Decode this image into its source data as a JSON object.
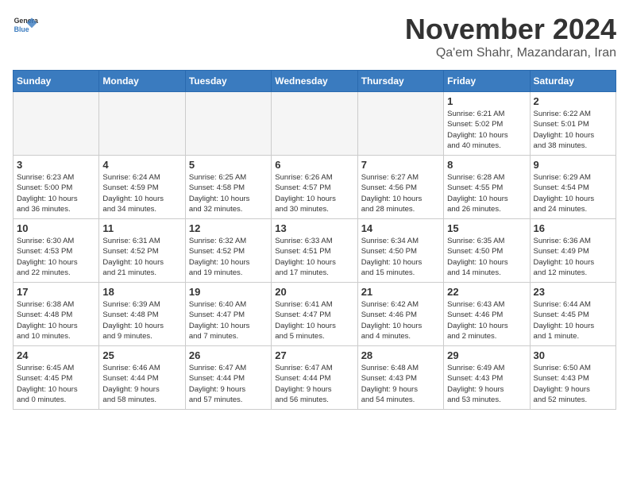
{
  "logo": {
    "line1": "General",
    "line2": "Blue"
  },
  "title": "November 2024",
  "location": "Qa'em Shahr, Mazandaran, Iran",
  "days_of_week": [
    "Sunday",
    "Monday",
    "Tuesday",
    "Wednesday",
    "Thursday",
    "Friday",
    "Saturday"
  ],
  "weeks": [
    [
      {
        "day": "",
        "info": ""
      },
      {
        "day": "",
        "info": ""
      },
      {
        "day": "",
        "info": ""
      },
      {
        "day": "",
        "info": ""
      },
      {
        "day": "",
        "info": ""
      },
      {
        "day": "1",
        "info": "Sunrise: 6:21 AM\nSunset: 5:02 PM\nDaylight: 10 hours\nand 40 minutes."
      },
      {
        "day": "2",
        "info": "Sunrise: 6:22 AM\nSunset: 5:01 PM\nDaylight: 10 hours\nand 38 minutes."
      }
    ],
    [
      {
        "day": "3",
        "info": "Sunrise: 6:23 AM\nSunset: 5:00 PM\nDaylight: 10 hours\nand 36 minutes."
      },
      {
        "day": "4",
        "info": "Sunrise: 6:24 AM\nSunset: 4:59 PM\nDaylight: 10 hours\nand 34 minutes."
      },
      {
        "day": "5",
        "info": "Sunrise: 6:25 AM\nSunset: 4:58 PM\nDaylight: 10 hours\nand 32 minutes."
      },
      {
        "day": "6",
        "info": "Sunrise: 6:26 AM\nSunset: 4:57 PM\nDaylight: 10 hours\nand 30 minutes."
      },
      {
        "day": "7",
        "info": "Sunrise: 6:27 AM\nSunset: 4:56 PM\nDaylight: 10 hours\nand 28 minutes."
      },
      {
        "day": "8",
        "info": "Sunrise: 6:28 AM\nSunset: 4:55 PM\nDaylight: 10 hours\nand 26 minutes."
      },
      {
        "day": "9",
        "info": "Sunrise: 6:29 AM\nSunset: 4:54 PM\nDaylight: 10 hours\nand 24 minutes."
      }
    ],
    [
      {
        "day": "10",
        "info": "Sunrise: 6:30 AM\nSunset: 4:53 PM\nDaylight: 10 hours\nand 22 minutes."
      },
      {
        "day": "11",
        "info": "Sunrise: 6:31 AM\nSunset: 4:52 PM\nDaylight: 10 hours\nand 21 minutes."
      },
      {
        "day": "12",
        "info": "Sunrise: 6:32 AM\nSunset: 4:52 PM\nDaylight: 10 hours\nand 19 minutes."
      },
      {
        "day": "13",
        "info": "Sunrise: 6:33 AM\nSunset: 4:51 PM\nDaylight: 10 hours\nand 17 minutes."
      },
      {
        "day": "14",
        "info": "Sunrise: 6:34 AM\nSunset: 4:50 PM\nDaylight: 10 hours\nand 15 minutes."
      },
      {
        "day": "15",
        "info": "Sunrise: 6:35 AM\nSunset: 4:50 PM\nDaylight: 10 hours\nand 14 minutes."
      },
      {
        "day": "16",
        "info": "Sunrise: 6:36 AM\nSunset: 4:49 PM\nDaylight: 10 hours\nand 12 minutes."
      }
    ],
    [
      {
        "day": "17",
        "info": "Sunrise: 6:38 AM\nSunset: 4:48 PM\nDaylight: 10 hours\nand 10 minutes."
      },
      {
        "day": "18",
        "info": "Sunrise: 6:39 AM\nSunset: 4:48 PM\nDaylight: 10 hours\nand 9 minutes."
      },
      {
        "day": "19",
        "info": "Sunrise: 6:40 AM\nSunset: 4:47 PM\nDaylight: 10 hours\nand 7 minutes."
      },
      {
        "day": "20",
        "info": "Sunrise: 6:41 AM\nSunset: 4:47 PM\nDaylight: 10 hours\nand 5 minutes."
      },
      {
        "day": "21",
        "info": "Sunrise: 6:42 AM\nSunset: 4:46 PM\nDaylight: 10 hours\nand 4 minutes."
      },
      {
        "day": "22",
        "info": "Sunrise: 6:43 AM\nSunset: 4:46 PM\nDaylight: 10 hours\nand 2 minutes."
      },
      {
        "day": "23",
        "info": "Sunrise: 6:44 AM\nSunset: 4:45 PM\nDaylight: 10 hours\nand 1 minute."
      }
    ],
    [
      {
        "day": "24",
        "info": "Sunrise: 6:45 AM\nSunset: 4:45 PM\nDaylight: 10 hours\nand 0 minutes."
      },
      {
        "day": "25",
        "info": "Sunrise: 6:46 AM\nSunset: 4:44 PM\nDaylight: 9 hours\nand 58 minutes."
      },
      {
        "day": "26",
        "info": "Sunrise: 6:47 AM\nSunset: 4:44 PM\nDaylight: 9 hours\nand 57 minutes."
      },
      {
        "day": "27",
        "info": "Sunrise: 6:47 AM\nSunset: 4:44 PM\nDaylight: 9 hours\nand 56 minutes."
      },
      {
        "day": "28",
        "info": "Sunrise: 6:48 AM\nSunset: 4:43 PM\nDaylight: 9 hours\nand 54 minutes."
      },
      {
        "day": "29",
        "info": "Sunrise: 6:49 AM\nSunset: 4:43 PM\nDaylight: 9 hours\nand 53 minutes."
      },
      {
        "day": "30",
        "info": "Sunrise: 6:50 AM\nSunset: 4:43 PM\nDaylight: 9 hours\nand 52 minutes."
      }
    ]
  ]
}
